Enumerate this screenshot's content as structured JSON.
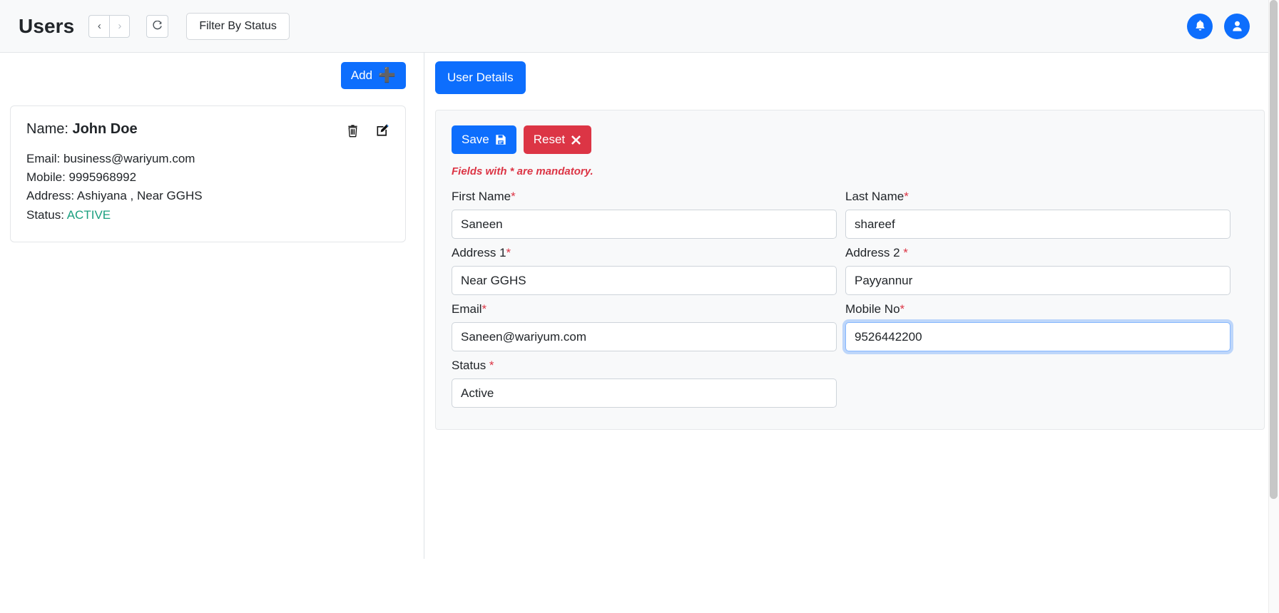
{
  "header": {
    "title": "Users",
    "nav": {
      "back": "‹",
      "forward": "›",
      "reload": "⟳"
    },
    "filter_label": "Filter By Status",
    "notification_icon": "bell-icon",
    "account_icon": "user-avatar-icon",
    "background": "#f8f9fa"
  },
  "left_panel": {
    "add_label": "Add",
    "add_icon": "plus-icon",
    "card": {
      "name_label": "Name:",
      "name_value": "John Doe",
      "email_line": "Email: business@wariyum.com",
      "mobile_line": "Mobile: 9995968992",
      "address_line": "Address: Ashiyana , Near GGHS",
      "status_label": "Status:",
      "status_value": "ACTIVE",
      "status_color": "#1a9f7f",
      "delete_icon": "trash-icon",
      "edit_icon": "edit-square-icon"
    }
  },
  "right_panel": {
    "tab_label": "User Details",
    "toolbar": {
      "save_label": "Save",
      "save_icon": "floppy-save-icon",
      "reset_label": "Reset",
      "reset_icon": "close-x-icon"
    },
    "mandatory_note": "Fields with * are mandatory.",
    "fields": [
      {
        "label": "First Name",
        "required": "*",
        "value": "Saneen",
        "focused": false
      },
      {
        "label": "Last Name",
        "required": "*",
        "value": "shareef",
        "focused": false
      },
      {
        "label": "Address 1",
        "required": "*",
        "value": "Near GGHS",
        "focused": false
      },
      {
        "label": "Address 2 ",
        "required": "*",
        "value": "Payyannur",
        "focused": false
      },
      {
        "label": "Email",
        "required": "*",
        "value": "Saneen@wariyum.com",
        "focused": false
      },
      {
        "label": "Mobile No",
        "required": "*",
        "value": "9526442200",
        "focused": true
      },
      {
        "label": "Status ",
        "required": "*",
        "value": "Active",
        "focused": false
      }
    ]
  },
  "colors": {
    "primary": "#0d6efd",
    "danger": "#dc3545",
    "panel_bg": "#f8f9fa",
    "border": "#dee2e6"
  }
}
